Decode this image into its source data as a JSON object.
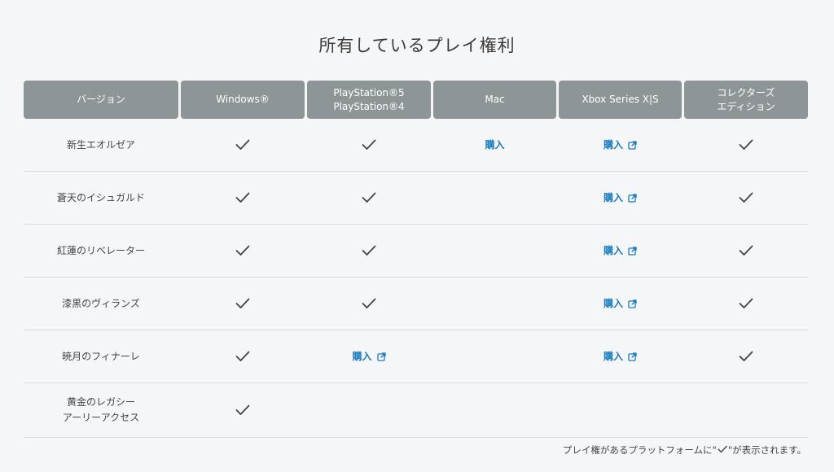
{
  "title": "所有しているプレイ権利",
  "header": {
    "version": "バージョン",
    "windows": "Windows®",
    "playstation_line1": "PlayStation®5",
    "playstation_line2": "PlayStation®4",
    "mac": "Mac",
    "xbox": "Xbox Series X|S",
    "collectors_line1": "コレクターズ",
    "collectors_line2": "エディション"
  },
  "buy_label": "購入",
  "rows": [
    {
      "name_line1": "新生エオルゼア",
      "name_line2": "",
      "windows": "check",
      "playstation": "check",
      "mac": "buy",
      "xbox": "buy-external",
      "collectors": "check"
    },
    {
      "name_line1": "蒼天のイシュガルド",
      "name_line2": "",
      "windows": "check",
      "playstation": "check",
      "mac": "",
      "xbox": "buy-external",
      "collectors": "check"
    },
    {
      "name_line1": "紅蓮のリベレーター",
      "name_line2": "",
      "windows": "check",
      "playstation": "check",
      "mac": "",
      "xbox": "buy-external",
      "collectors": "check"
    },
    {
      "name_line1": "漆黒のヴィランズ",
      "name_line2": "",
      "windows": "check",
      "playstation": "check",
      "mac": "",
      "xbox": "buy-external",
      "collectors": "check"
    },
    {
      "name_line1": "暁月のフィナーレ",
      "name_line2": "",
      "windows": "check",
      "playstation": "buy-external",
      "mac": "",
      "xbox": "buy-external",
      "collectors": "check"
    },
    {
      "name_line1": "黄金のレガシー",
      "name_line2": "アーリーアクセス",
      "windows": "check",
      "playstation": "",
      "mac": "",
      "xbox": "",
      "collectors": ""
    }
  ],
  "footnote": {
    "prefix": "プレイ権があるプラットフォームに\"",
    "suffix": "\"が表示されます。"
  },
  "colors": {
    "header_bg": "#8e9599",
    "link": "#1a7bbd",
    "check": "#444444",
    "divider": "#d8dadc"
  },
  "icons": {
    "check": "check-icon",
    "external": "external-link-icon"
  }
}
